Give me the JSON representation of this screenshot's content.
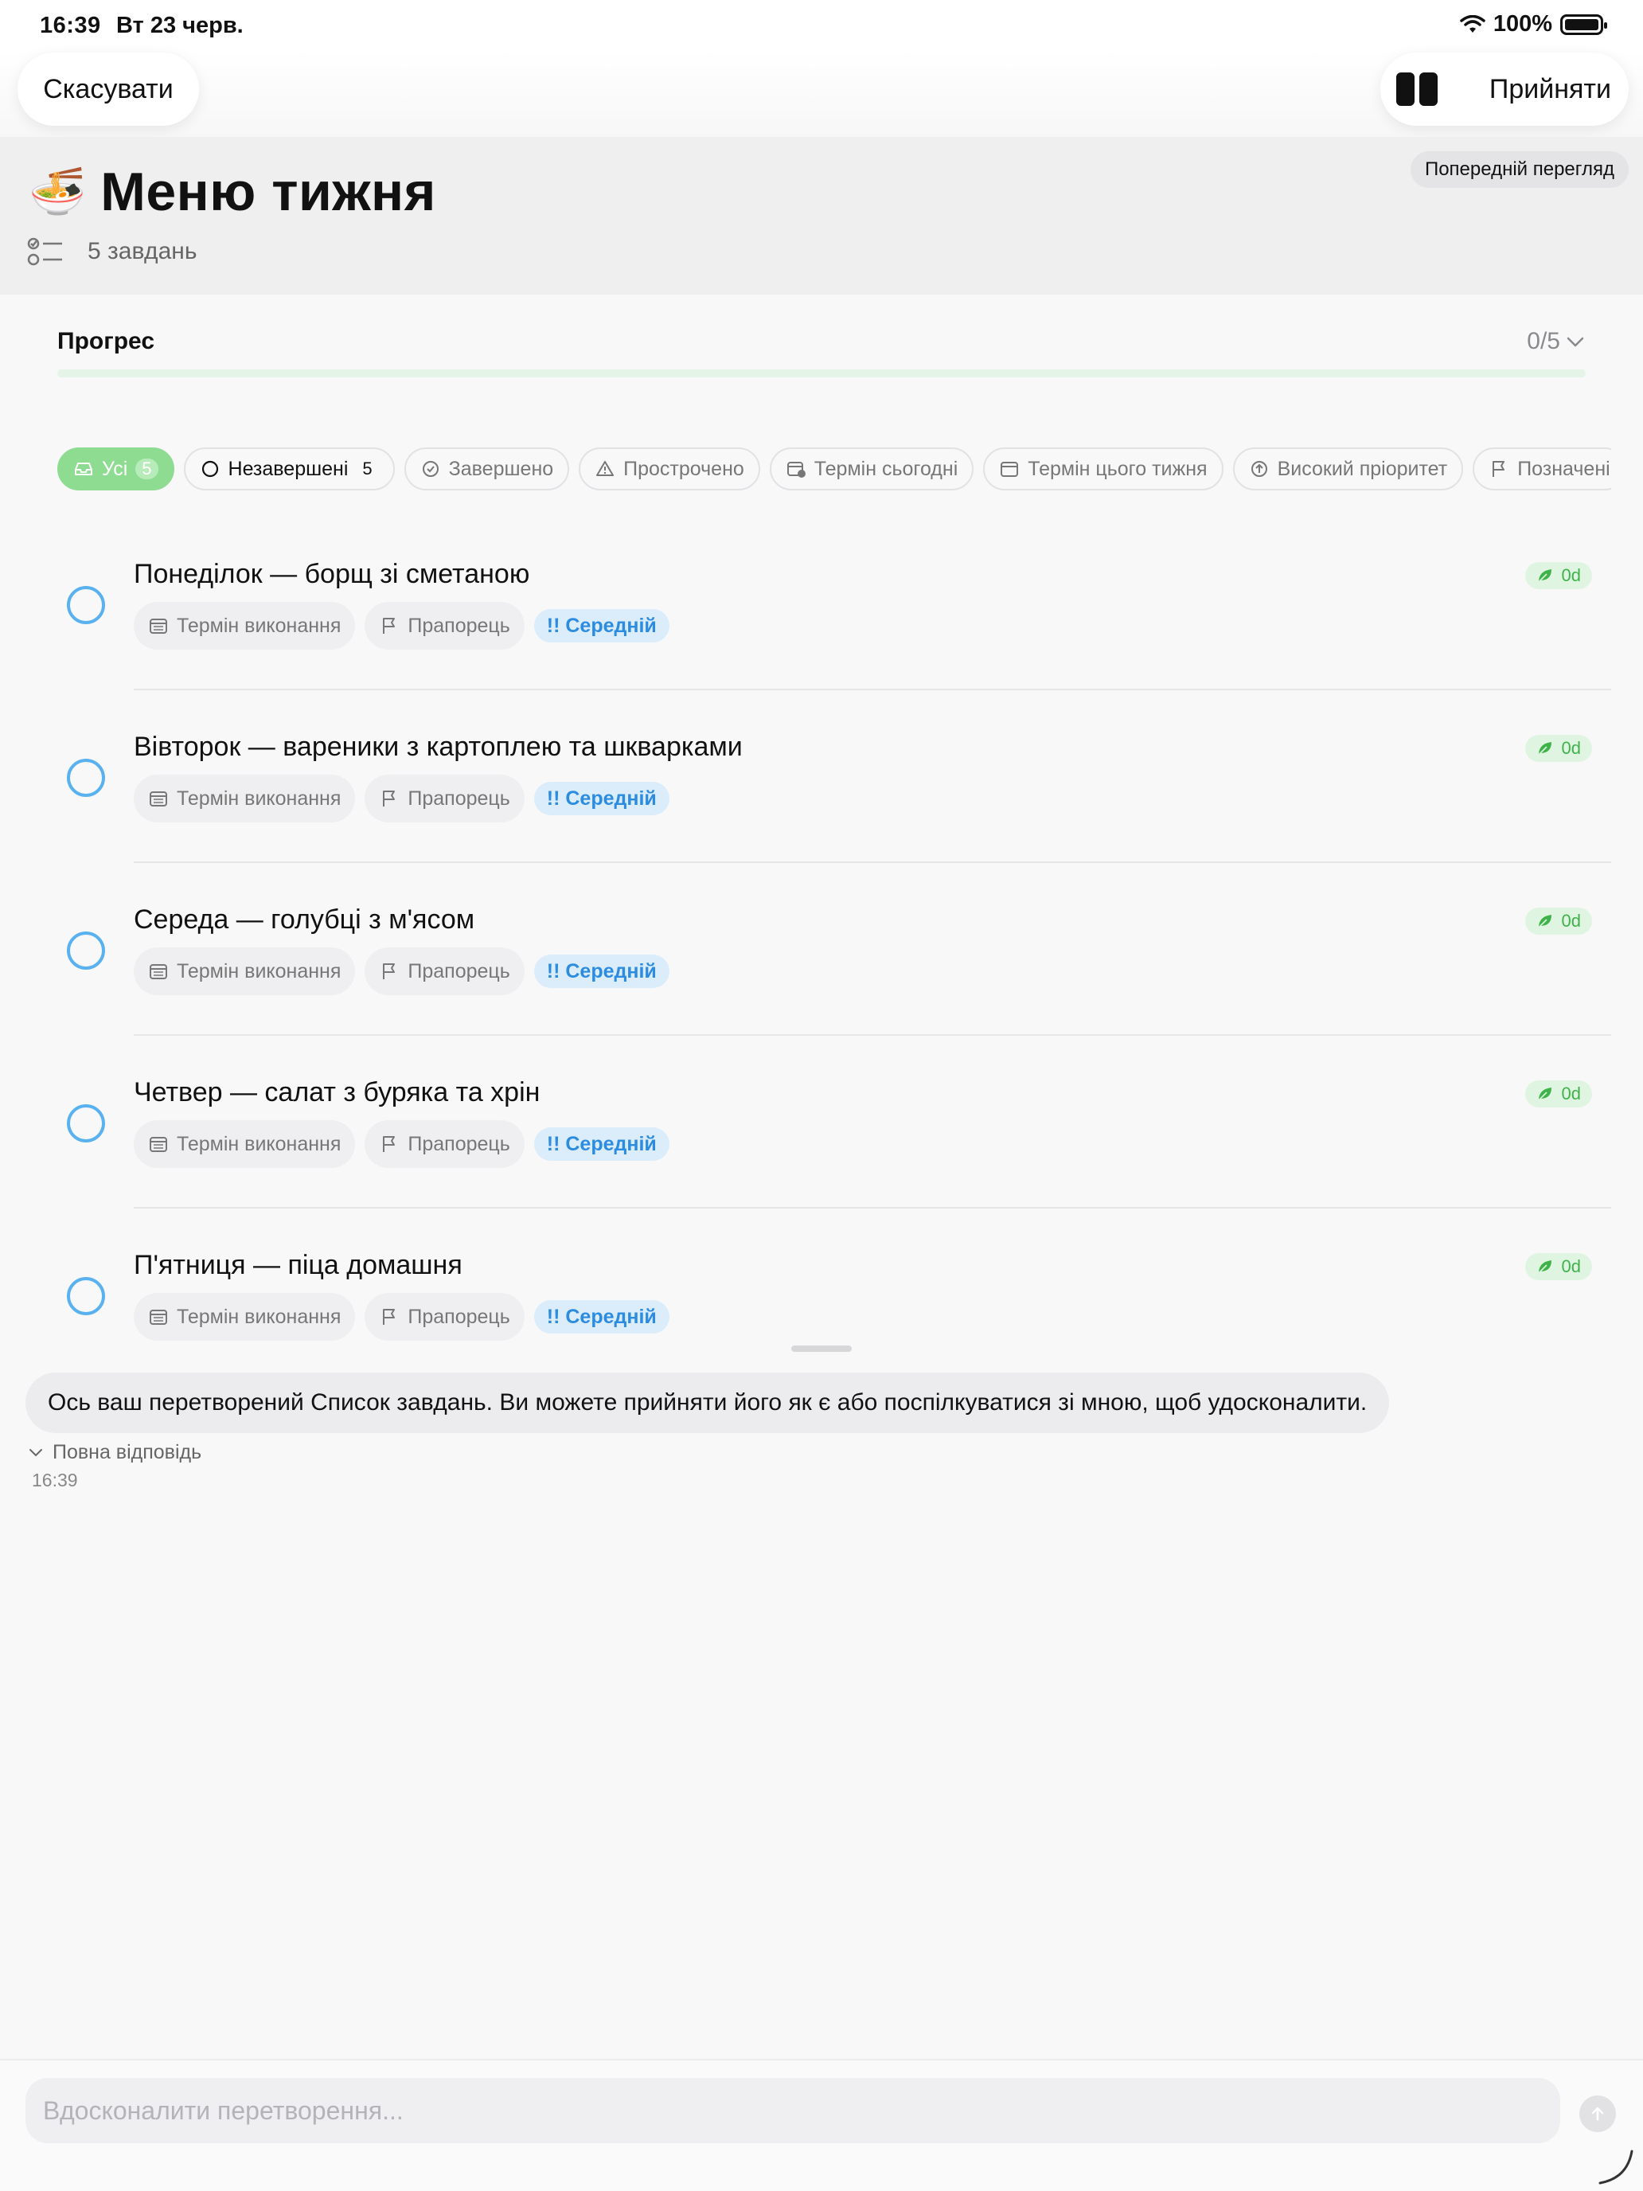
{
  "status_bar": {
    "time": "16:39",
    "date": "Вт 23 черв.",
    "battery": "100%"
  },
  "nav": {
    "cancel_label": "Скасувати",
    "accept_label": "Прийняти"
  },
  "header": {
    "preview_label": "Попередній перегляд",
    "emoji": "🍜",
    "title": "Меню тижня",
    "task_count": "5 завдань"
  },
  "progress": {
    "label": "Прогрес",
    "value": "0/5",
    "fraction": 0
  },
  "filters": [
    {
      "label": "Усі",
      "count": "5",
      "icon": "inbox-icon"
    },
    {
      "label": "Незавершені",
      "count": "5",
      "icon": "circle-icon"
    },
    {
      "label": "Завершено",
      "icon": "check-circle-icon"
    },
    {
      "label": "Прострочено",
      "icon": "warning-icon"
    },
    {
      "label": "Термін сьогодні",
      "icon": "calendar-clock-icon"
    },
    {
      "label": "Термін цього тижня",
      "icon": "calendar-icon"
    },
    {
      "label": "Високий пріоритет",
      "icon": "arrow-up-circle-icon"
    },
    {
      "label": "Позначені",
      "icon": "flag-icon"
    }
  ],
  "task_meta": {
    "due_label": "Термін виконання",
    "flag_label": "Прапорець",
    "priority_label": "!! Середній",
    "tag_label": "0d"
  },
  "tasks": [
    {
      "title": "Понеділок — борщ зі сметаною"
    },
    {
      "title": "Вівторок — вареники з картоплею та шкварками"
    },
    {
      "title": "Середа — голубці з м'ясом"
    },
    {
      "title": "Четвер — салат з буряка та хрін"
    },
    {
      "title": "П'ятниця — піца домашня"
    }
  ],
  "chat": {
    "message": "Ось ваш перетворений Список завдань. Ви можете прийняти його як є або поспілкуватися зі мною, щоб удосконалити.",
    "full_answer_label": "Повна відповідь",
    "time": "16:39"
  },
  "composer": {
    "placeholder": "Вдосконалити перетворення..."
  },
  "colors": {
    "accent_green": "#8edc92",
    "circle_blue": "#5ab1f0",
    "priority_blue": "#2b8ce0"
  }
}
